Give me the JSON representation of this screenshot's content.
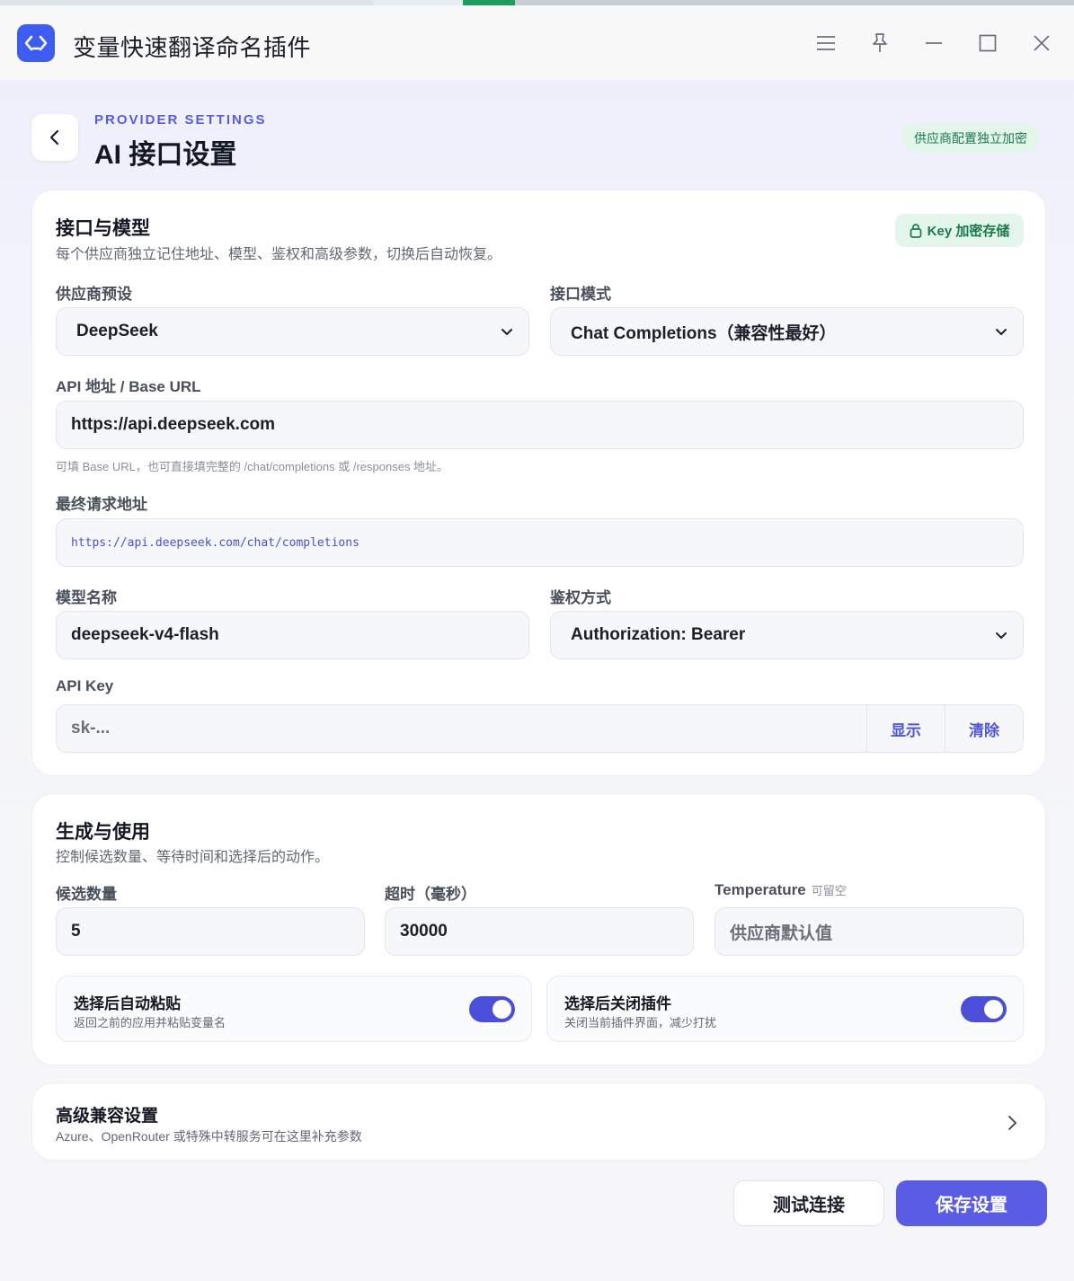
{
  "app": {
    "title": "变量快速翻译命名插件"
  },
  "header": {
    "eyebrow": "PROVIDER SETTINGS",
    "title": "AI 接口设置",
    "badge": "供应商配置独立加密"
  },
  "interface": {
    "title": "接口与模型",
    "subtitle": "每个供应商独立记住地址、模型、鉴权和高级参数，切换后自动恢复。",
    "key_badge": "Key 加密存储",
    "provider": {
      "label": "供应商预设",
      "value": "DeepSeek"
    },
    "mode": {
      "label": "接口模式",
      "value": "Chat Completions（兼容性最好）"
    },
    "base_url": {
      "label": "API 地址 / Base URL",
      "value": "https://api.deepseek.com",
      "hint": "可填 Base URL，也可直接填完整的 /chat/completions 或 /responses 地址。"
    },
    "final_url": {
      "label": "最终请求地址",
      "value": "https://api.deepseek.com/chat/completions"
    },
    "model": {
      "label": "模型名称",
      "value": "deepseek-v4-flash"
    },
    "auth": {
      "label": "鉴权方式",
      "value": "Authorization: Bearer"
    },
    "api_key": {
      "label": "API Key",
      "placeholder": "sk-...",
      "show_label": "显示",
      "clear_label": "清除"
    }
  },
  "generation": {
    "title": "生成与使用",
    "subtitle": "控制候选数量、等待时间和选择后的动作。",
    "count": {
      "label": "候选数量",
      "value": "5"
    },
    "timeout": {
      "label": "超时（毫秒）",
      "value": "30000"
    },
    "temperature": {
      "label": "Temperature",
      "optional": "可留空",
      "placeholder": "供应商默认值"
    },
    "auto_paste": {
      "title": "选择后自动粘贴",
      "subtitle": "返回之前的应用并粘贴变量名",
      "enabled": true
    },
    "close_after": {
      "title": "选择后关闭插件",
      "subtitle": "关闭当前插件界面，减少打扰",
      "enabled": true
    }
  },
  "advanced": {
    "title": "高级兼容设置",
    "subtitle": "Azure、OpenRouter 或特殊中转服务可在这里补充参数"
  },
  "actions": {
    "test": "测试连接",
    "save": "保存设置"
  },
  "colors": {
    "accent": "#5b5ce6",
    "success_bg": "#e4f5ec",
    "success_text": "#1a7a4d",
    "logo": "#3f5cf0"
  }
}
